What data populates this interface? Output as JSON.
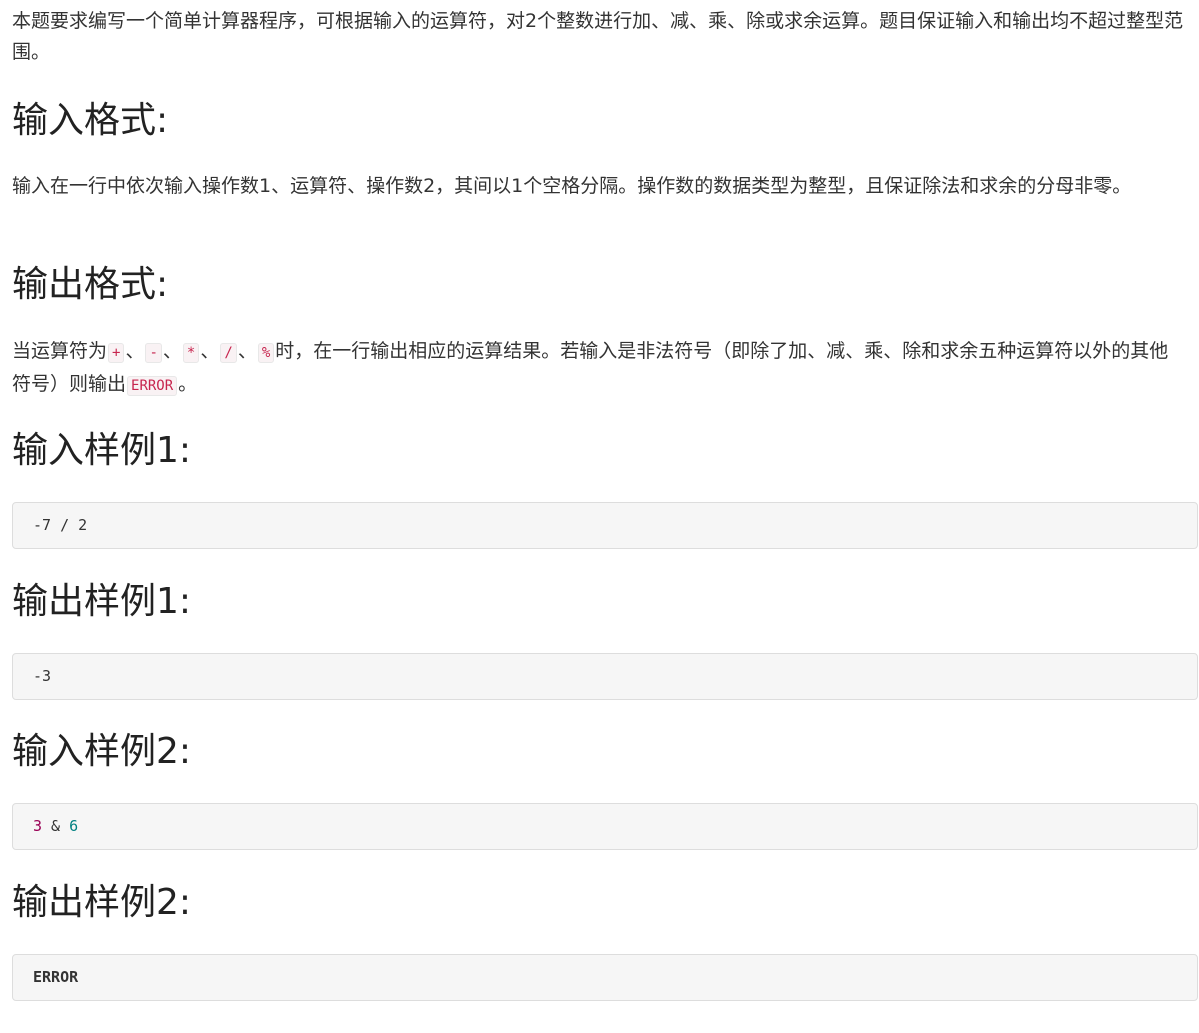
{
  "intro": "本题要求编写一个简单计算器程序，可根据输入的运算符，对2个整数进行加、减、乘、除或求余运算。题目保证输入和输出均不超过整型范围。",
  "input_format": {
    "heading": "输入格式:",
    "text": "输入在一行中依次输入操作数1、运算符、操作数2，其间以1个空格分隔。操作数的数据类型为整型，且保证除法和求余的分母非零。"
  },
  "output_format": {
    "heading": "输出格式:",
    "text_prefix": "当运算符为",
    "operators": [
      "+",
      "-",
      "*",
      "/",
      "%"
    ],
    "separator": "、",
    "text_middle": "时，在一行输出相应的运算结果。若输入是非法符号（即除了加、减、乘、除和求余五种运算符以外的其他符号）则输出",
    "error_code": "ERROR",
    "text_suffix": "。"
  },
  "samples": [
    {
      "heading": "输入样例1:",
      "tokens": [
        "-7",
        " / ",
        "2"
      ]
    },
    {
      "heading": "输出样例1:",
      "tokens": [
        "-3"
      ]
    },
    {
      "heading": "输入样例2:",
      "tokens": [
        "3",
        " & ",
        "6"
      ]
    },
    {
      "heading": "输出样例2:",
      "tokens": [
        "ERROR"
      ]
    }
  ]
}
